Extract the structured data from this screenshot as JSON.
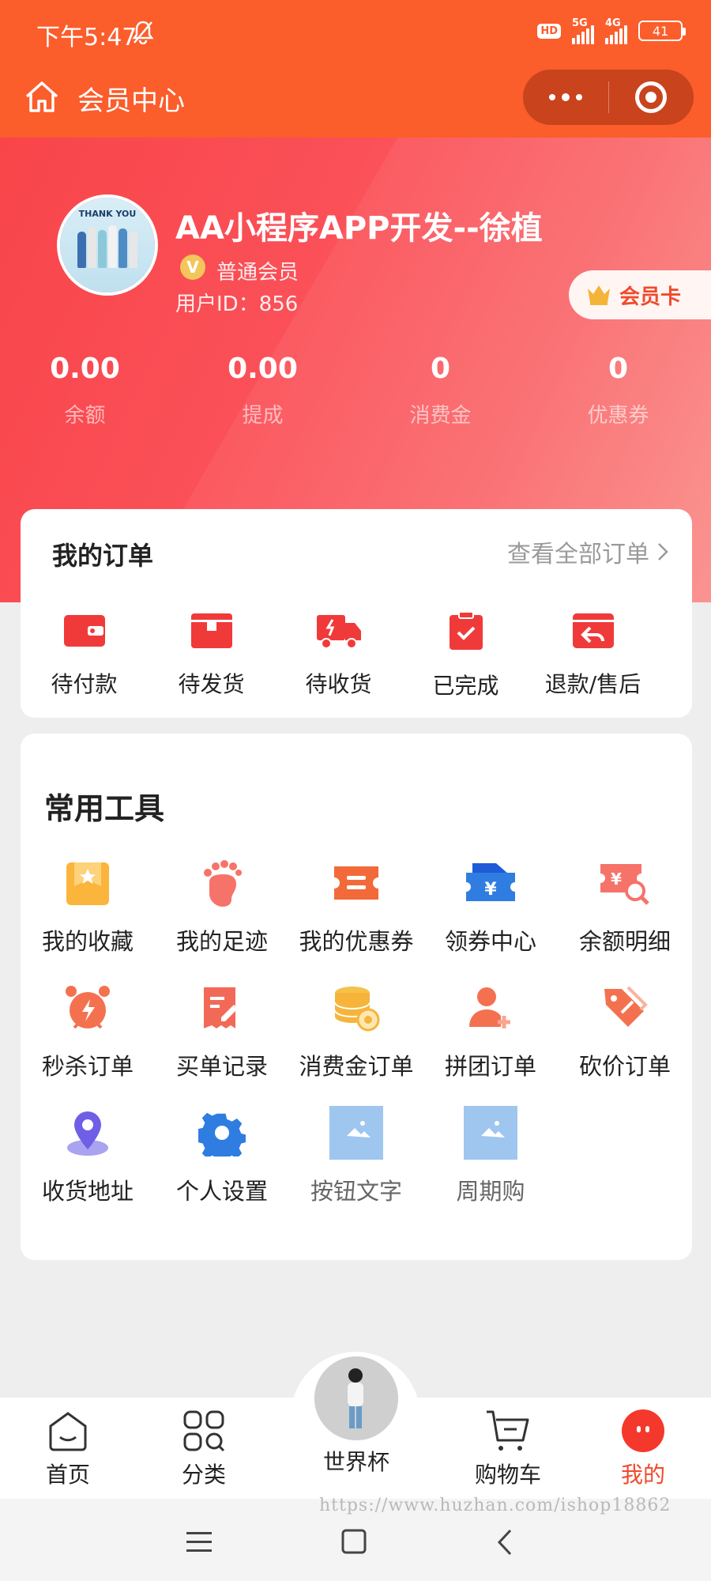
{
  "status_bar": {
    "time": "下午5:47",
    "hd": "HD",
    "net1": "5G",
    "net2": "4G",
    "battery": "41"
  },
  "nav": {
    "title": "会员中心"
  },
  "profile": {
    "name": "AA小程序APP开发--徐植",
    "avatar_text": "THANK YOU",
    "level": "普通会员",
    "user_id": "用户ID：856",
    "member_card": "会员卡"
  },
  "stats": [
    {
      "value": "0.00",
      "label": "余额"
    },
    {
      "value": "0.00",
      "label": "提成"
    },
    {
      "value": "0",
      "label": "消费金"
    },
    {
      "value": "0",
      "label": "优惠券"
    }
  ],
  "orders": {
    "title": "我的订单",
    "view_all": "查看全部订单",
    "items": [
      {
        "label": "待付款",
        "icon": "wallet-icon"
      },
      {
        "label": "待发货",
        "icon": "box-icon"
      },
      {
        "label": "待收货",
        "icon": "truck-icon"
      },
      {
        "label": "已完成",
        "icon": "clipboard-check-icon"
      },
      {
        "label": "退款/售后",
        "icon": "refund-icon"
      }
    ]
  },
  "tools": {
    "title": "常用工具",
    "items": [
      {
        "label": "我的收藏",
        "icon": "star-folder-icon"
      },
      {
        "label": "我的足迹",
        "icon": "footprint-icon"
      },
      {
        "label": "我的优惠券",
        "icon": "coupon-icon"
      },
      {
        "label": "领券中心",
        "icon": "ticket-yuan-icon"
      },
      {
        "label": "余额明细",
        "icon": "balance-search-icon"
      },
      {
        "label": "秒杀订单",
        "icon": "alarm-clock-icon"
      },
      {
        "label": "买单记录",
        "icon": "record-edit-icon"
      },
      {
        "label": "消费金订单",
        "icon": "coins-icon"
      },
      {
        "label": "拼团订单",
        "icon": "user-add-icon"
      },
      {
        "label": "砍价订单",
        "icon": "price-tag-icon"
      },
      {
        "label": "收货地址",
        "icon": "location-pin-icon"
      },
      {
        "label": "个人设置",
        "icon": "gear-icon"
      },
      {
        "label": "按钮文字",
        "icon": "image-placeholder-icon"
      },
      {
        "label": "周期购",
        "icon": "image-placeholder-icon"
      }
    ]
  },
  "tabbar": {
    "items": [
      {
        "label": "首页",
        "icon": "home-icon"
      },
      {
        "label": "分类",
        "icon": "category-icon"
      },
      {
        "label": "世界杯",
        "icon": "avatar"
      },
      {
        "label": "购物车",
        "icon": "cart-icon"
      },
      {
        "label": "我的",
        "icon": "profile-icon",
        "active": true
      }
    ]
  },
  "watermark": "https://www.huzhan.com/ishop18862",
  "colors": {
    "primary": "#fb5d2b",
    "accent": "#f04a2c",
    "hero": "#f8454a",
    "tool_blue": "#2f7de1"
  }
}
